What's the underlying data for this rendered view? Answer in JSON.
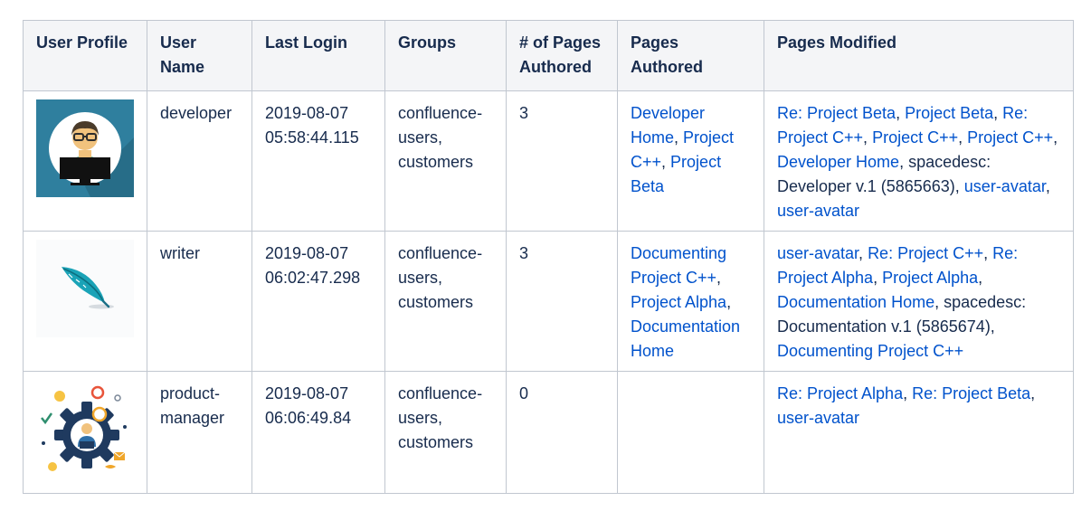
{
  "columns": {
    "user_profile": "User Profile",
    "user_name": "User Name",
    "last_login": "Last Login",
    "groups": "Groups",
    "pages_count": "# of Pages Authored",
    "pages_authored": "Pages Authored",
    "pages_modified": "Pages Modified"
  },
  "rows": [
    {
      "avatar_icon": "developer-at-computer-avatar",
      "user_name": "developer",
      "last_login": "2019-08-07 05:58:44.115",
      "groups": "confluence-users, customers",
      "pages_count": "3",
      "authored": [
        {
          "text": "Developer Home",
          "link": true
        },
        {
          "text": ", ",
          "link": false
        },
        {
          "text": "Project C++",
          "link": true
        },
        {
          "text": ", ",
          "link": false
        },
        {
          "text": "Project Beta",
          "link": true
        }
      ],
      "modified": [
        {
          "text": "Re: Project Beta",
          "link": true
        },
        {
          "text": ", ",
          "link": false
        },
        {
          "text": "Project Beta",
          "link": true
        },
        {
          "text": ", ",
          "link": false
        },
        {
          "text": "Re: Project C++",
          "link": true
        },
        {
          "text": ", ",
          "link": false
        },
        {
          "text": "Project C++",
          "link": true
        },
        {
          "text": ", ",
          "link": false
        },
        {
          "text": "Project C++",
          "link": true
        },
        {
          "text": ", ",
          "link": false
        },
        {
          "text": "Developer Home",
          "link": true
        },
        {
          "text": ", spacedesc: Developer v.1 (5865663), ",
          "link": false
        },
        {
          "text": "user-avatar",
          "link": true
        },
        {
          "text": ", ",
          "link": false
        },
        {
          "text": "user-avatar",
          "link": true
        }
      ]
    },
    {
      "avatar_icon": "quill-feather-avatar",
      "user_name": "writer",
      "last_login": "2019-08-07 06:02:47.298",
      "groups": "confluence-users, customers",
      "pages_count": "3",
      "authored": [
        {
          "text": "Documenting Project C++",
          "link": true
        },
        {
          "text": ", ",
          "link": false
        },
        {
          "text": "Project Alpha",
          "link": true
        },
        {
          "text": ", ",
          "link": false
        },
        {
          "text": "Documentation Home",
          "link": true
        }
      ],
      "modified": [
        {
          "text": "user-avatar",
          "link": true
        },
        {
          "text": ", ",
          "link": false
        },
        {
          "text": "Re: Project C++",
          "link": true
        },
        {
          "text": ", ",
          "link": false
        },
        {
          "text": "Re: Project Alpha",
          "link": true
        },
        {
          "text": ", ",
          "link": false
        },
        {
          "text": "Project Alpha",
          "link": true
        },
        {
          "text": ", ",
          "link": false
        },
        {
          "text": "Documentation Home",
          "link": true
        },
        {
          "text": ", spacedesc: Documentation v.1 (5865674), ",
          "link": false
        },
        {
          "text": "Documenting Project C++",
          "link": true
        }
      ]
    },
    {
      "avatar_icon": "gear-manager-avatar",
      "user_name": "product-manager",
      "last_login": "2019-08-07 06:06:49.84",
      "groups": "confluence-users, customers",
      "pages_count": "0",
      "authored": [],
      "modified": [
        {
          "text": "Re: Project Alpha",
          "link": true
        },
        {
          "text": ", ",
          "link": false
        },
        {
          "text": "Re: Project Beta",
          "link": true
        },
        {
          "text": ", ",
          "link": false
        },
        {
          "text": "user-avatar",
          "link": true
        }
      ]
    }
  ],
  "colors": {
    "link": "#0052cc",
    "text": "#172b4d",
    "header_bg": "#f4f5f7",
    "border": "#c1c7d0",
    "developer_avatar_bg": "#2f7f9e"
  }
}
